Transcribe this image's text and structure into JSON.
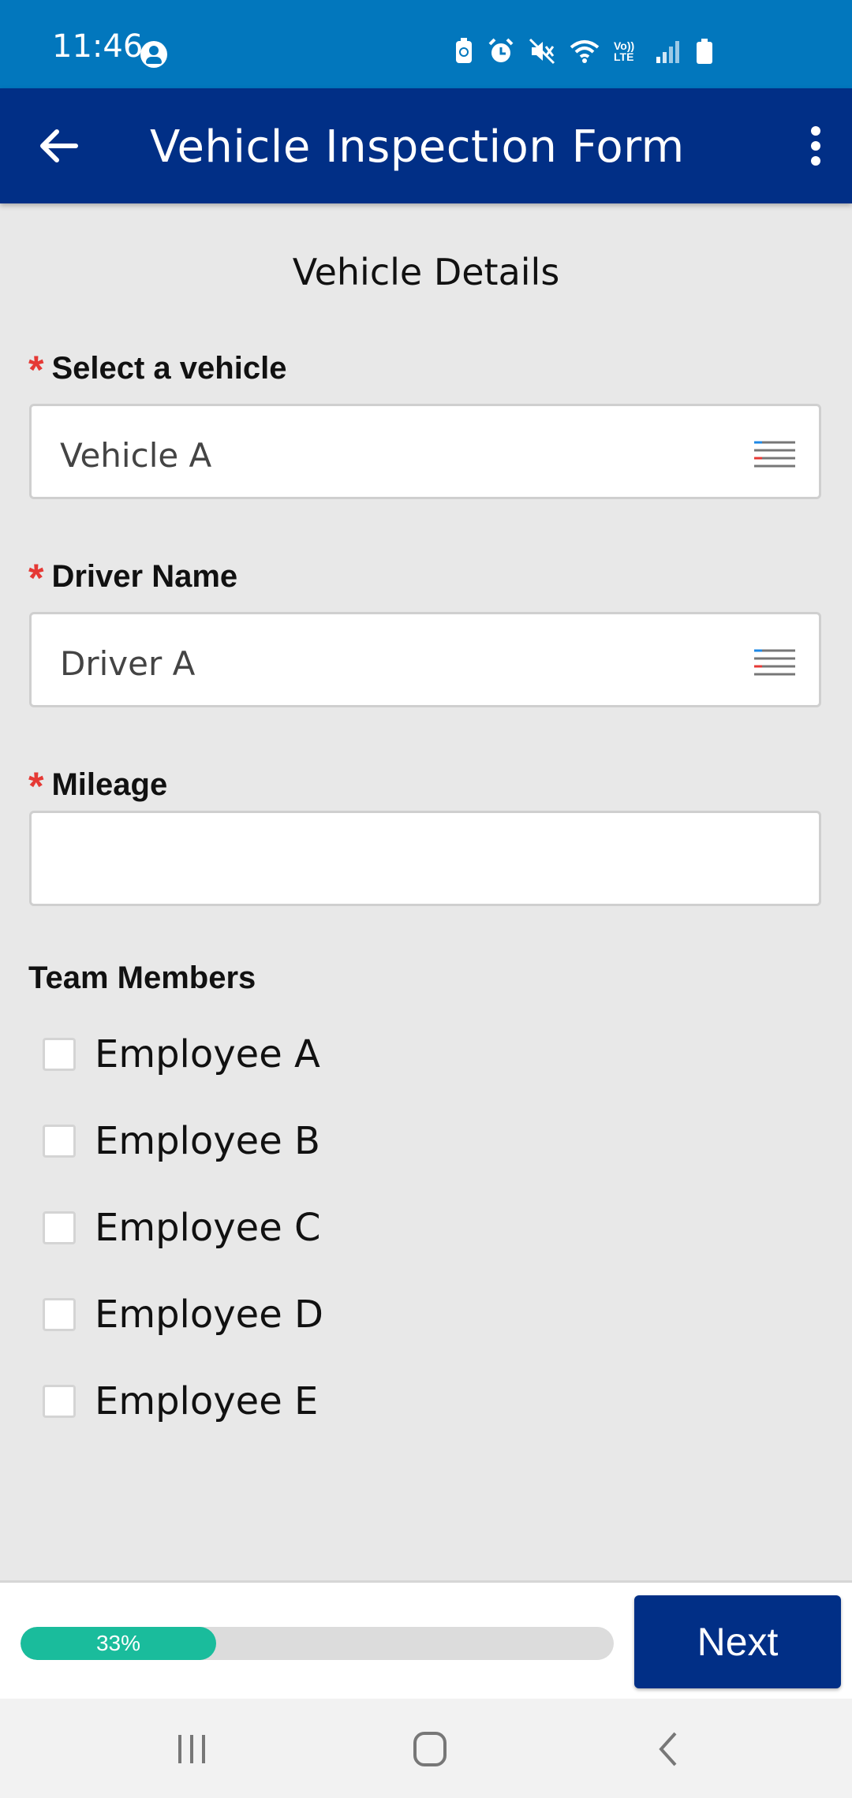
{
  "status_bar": {
    "time": "11:46",
    "icons": [
      "account-icon",
      "battery-saver-icon",
      "alarm-icon",
      "mute-icon",
      "wifi-icon",
      "volte-icon",
      "signal-icon",
      "battery-icon"
    ],
    "volte_label": "Vo)) LTE"
  },
  "app_bar": {
    "title": "Vehicle Inspection Form",
    "background_color": "#012f86"
  },
  "section_title": "Vehicle Details",
  "fields": {
    "vehicle": {
      "label": "Select a vehicle",
      "value": "Vehicle A",
      "required_mark": "*"
    },
    "driver": {
      "label": "Driver Name",
      "value": "Driver A",
      "required_mark": "*"
    },
    "mileage": {
      "label": "Mileage",
      "value": "",
      "required_mark": "*"
    }
  },
  "team": {
    "title": "Team Members",
    "members": [
      {
        "label": "Employee A",
        "checked": false
      },
      {
        "label": "Employee B",
        "checked": false
      },
      {
        "label": "Employee C",
        "checked": false
      },
      {
        "label": "Employee D",
        "checked": false
      },
      {
        "label": "Employee E",
        "checked": false
      }
    ]
  },
  "footer": {
    "progress_text": "33%",
    "progress_value": 0.33,
    "progress_color": "#1abc9c",
    "next_label": "Next"
  }
}
